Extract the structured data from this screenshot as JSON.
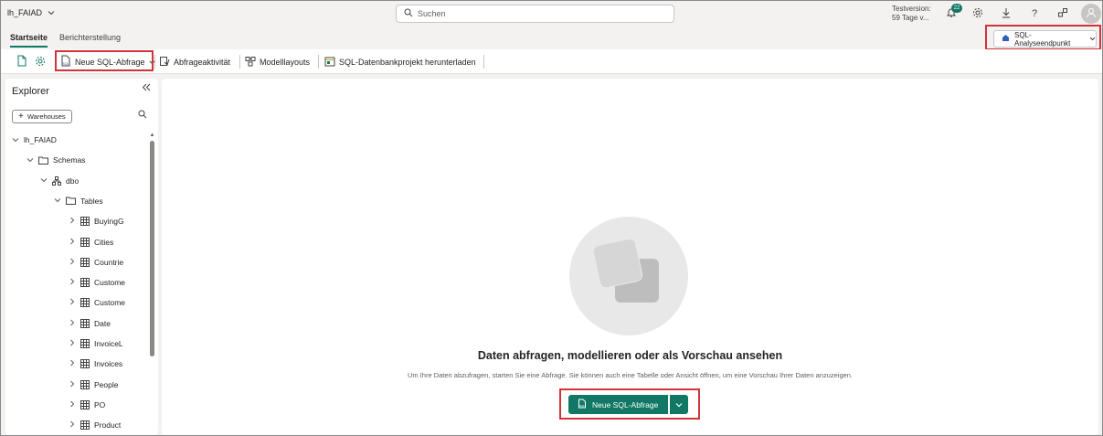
{
  "header": {
    "workspace_name": "lh_FAIAD",
    "search_placeholder": "Suchen",
    "trial_line1": "Testversion:",
    "trial_line2": "59 Tage v...",
    "notification_count": "22"
  },
  "tabs": [
    {
      "label": "Startseite",
      "active": true
    },
    {
      "label": "Berichterstellung",
      "active": false
    }
  ],
  "endpoint_selector": {
    "label": "SQL-Analyseendpunkt"
  },
  "toolbar": {
    "new_sql_query": "Neue SQL-Abfrage",
    "query_activity": "Abfrageaktivität",
    "model_layouts": "Modelllayouts",
    "download_project": "SQL-Datenbankprojekt herunterladen"
  },
  "explorer": {
    "title": "Explorer",
    "add_button": "Warehouses",
    "tree": [
      {
        "label": "lh_FAIAD",
        "level": 0,
        "icon": "none"
      },
      {
        "label": "Schemas",
        "level": 1,
        "icon": "folder-icon"
      },
      {
        "label": "dbo",
        "level": 2,
        "icon": "schema-icon"
      },
      {
        "label": "Tables",
        "level": 3,
        "icon": "folder-icon"
      },
      {
        "label": "BuyingG",
        "level": 4,
        "icon": "table-icon"
      },
      {
        "label": "Cities",
        "level": 4,
        "icon": "table-icon"
      },
      {
        "label": "Countrie",
        "level": 4,
        "icon": "table-icon"
      },
      {
        "label": "Custome",
        "level": 4,
        "icon": "table-icon"
      },
      {
        "label": "Custome",
        "level": 4,
        "icon": "table-icon"
      },
      {
        "label": "Date",
        "level": 4,
        "icon": "table-icon"
      },
      {
        "label": "InvoiceL",
        "level": 4,
        "icon": "table-icon"
      },
      {
        "label": "Invoices",
        "level": 4,
        "icon": "table-icon"
      },
      {
        "label": "People",
        "level": 4,
        "icon": "table-icon"
      },
      {
        "label": "PO",
        "level": 4,
        "icon": "table-icon"
      },
      {
        "label": "Product",
        "level": 4,
        "icon": "table-icon"
      }
    ]
  },
  "main": {
    "heading": "Daten abfragen, modellieren oder als Vorschau ansehen",
    "subtext": "Um Ihre Daten abzufragen, starten Sie eine Abfrage. Sie können auch eine Tabelle oder Ansicht öffnen, um eine Vorschau Ihrer Daten anzuzeigen.",
    "cta_label": "Neue SQL-Abfrage"
  },
  "colors": {
    "accent": "#117865",
    "highlight": "#d13438"
  }
}
